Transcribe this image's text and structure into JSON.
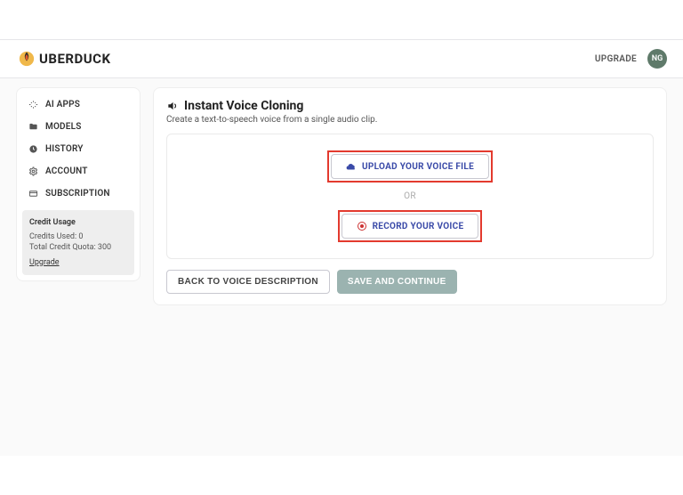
{
  "brand": {
    "name": "UBERDUCK"
  },
  "header": {
    "upgrade": "UPGRADE",
    "avatar_initials": "NG"
  },
  "sidebar": {
    "items": [
      {
        "label": "AI APPS"
      },
      {
        "label": "MODELS"
      },
      {
        "label": "HISTORY"
      },
      {
        "label": "ACCOUNT"
      },
      {
        "label": "SUBSCRIPTION"
      }
    ],
    "credit": {
      "title": "Credit Usage",
      "used": "Credits Used: 0",
      "total": "Total Credit Quota: 300",
      "upgrade": "Upgrade"
    }
  },
  "main": {
    "title": "Instant Voice Cloning",
    "subtitle": "Create a text-to-speech voice from a single audio clip.",
    "upload_label": "UPLOAD YOUR VOICE FILE",
    "or": "OR",
    "record_label": "RECORD YOUR VOICE",
    "back_label": "BACK TO VOICE DESCRIPTION",
    "save_label": "SAVE AND CONTINUE"
  }
}
